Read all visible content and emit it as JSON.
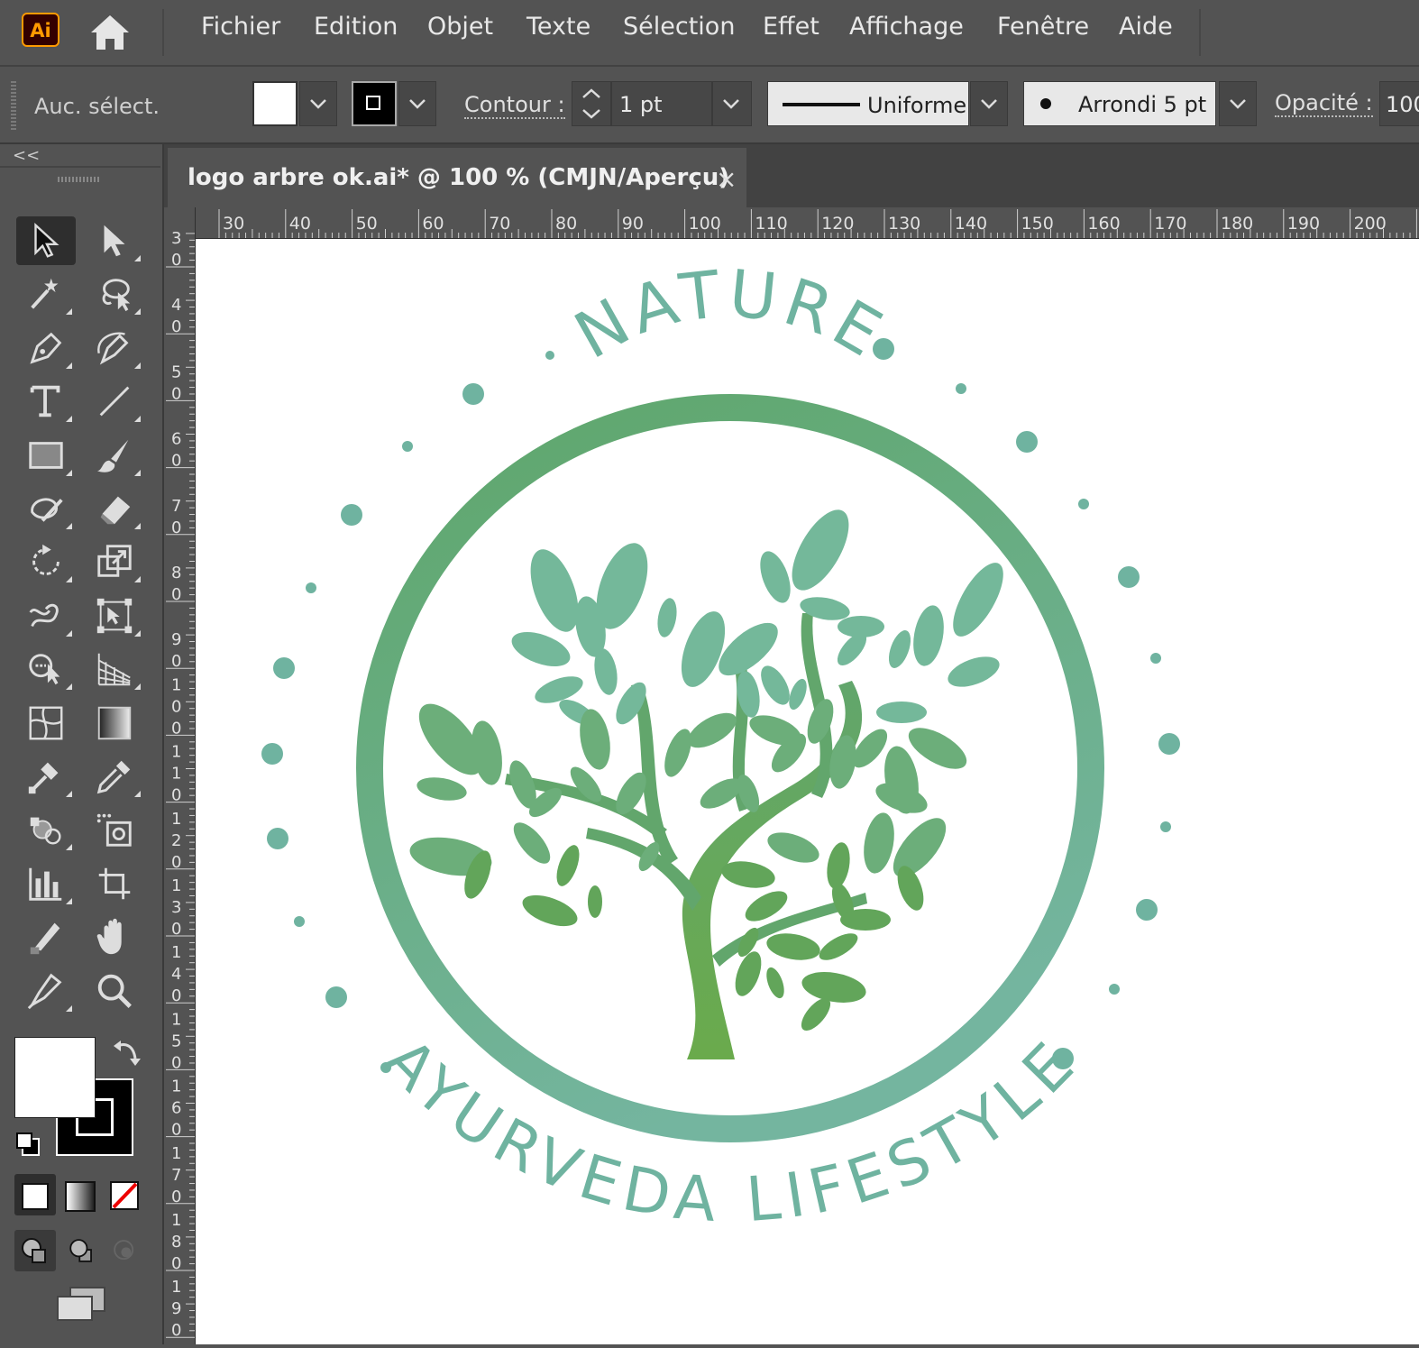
{
  "app": {
    "logo_text": "Ai"
  },
  "menu": [
    "Fichier",
    "Edition",
    "Objet",
    "Texte",
    "Sélection",
    "Effet",
    "Affichage",
    "Fenêtre",
    "Aide"
  ],
  "control_bar": {
    "selection_status": "Auc. sélect.",
    "stroke_label": "Contour :",
    "stroke_weight": "1 pt",
    "profile_label": "Uniforme",
    "brush_label": "Arrondi 5 pt",
    "opacity_label": "Opacité :",
    "opacity_value": "100"
  },
  "document": {
    "tab_title": "logo arbre ok.ai* @ 100 % (CMJN/Aperçu)",
    "close_icon": "×"
  },
  "panel_collapse": "<<",
  "ruler": {
    "h_ticks": [
      "30",
      "40",
      "50",
      "60",
      "70",
      "80",
      "90",
      "100",
      "110",
      "120",
      "130",
      "140",
      "150",
      "160",
      "170",
      "180",
      "190",
      "200"
    ],
    "v_ticks": [
      "30",
      "40",
      "50",
      "60",
      "70",
      "80",
      "90",
      "100",
      "110",
      "120",
      "130",
      "140",
      "150",
      "160",
      "170",
      "180",
      "190"
    ]
  },
  "artwork": {
    "top_text": "NATURE",
    "bottom_text": "AYURVEDA LIFESTYLE",
    "colors": {
      "ring_top": "#5ea66a",
      "ring_bottom": "#74b59f",
      "teal": "#6fb3a0",
      "leaf_dark": "#62a55a",
      "leaf_light": "#74b89a"
    }
  },
  "tools": [
    "selection-tool",
    "direct-selection-tool",
    "magic-wand-tool",
    "lasso-tool",
    "pen-tool",
    "curvature-tool",
    "type-tool",
    "line-segment-tool",
    "rectangle-tool",
    "paintbrush-tool",
    "shaper-tool",
    "eraser-tool",
    "rotate-tool",
    "scale-tool",
    "warp-tool",
    "free-transform-tool",
    "shape-builder-tool",
    "perspective-grid-tool",
    "mesh-tool",
    "gradient-tool",
    "blend-tool",
    "eyedropper-tool",
    "symbol-sprayer-tool",
    "live-paint-tool",
    "column-graph-tool",
    "artboard-tool",
    "slice-tool",
    "hand-tool",
    "puppet-warp-tool",
    "zoom-tool"
  ]
}
